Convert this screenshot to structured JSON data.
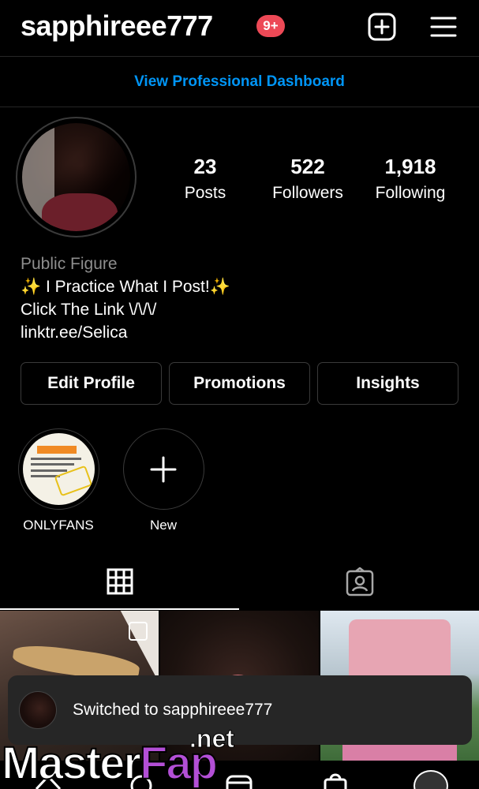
{
  "header": {
    "username": "sapphireee777",
    "notification_badge": "9+",
    "icons": [
      "add-post-icon",
      "menu-icon"
    ]
  },
  "professional_dashboard": {
    "label": "View Professional Dashboard",
    "color": "#0095f6"
  },
  "profile": {
    "stats": [
      {
        "value": "23",
        "label": "Posts"
      },
      {
        "value": "522",
        "label": "Followers"
      },
      {
        "value": "1,918",
        "label": "Following"
      }
    ],
    "category": "Public Figure",
    "bio_lines": [
      "✨ I Practice What I Post!✨",
      "Click The Link \\/\\/\\/"
    ],
    "link": "linktr.ee/Selica"
  },
  "actions": {
    "edit_profile": "Edit Profile",
    "promotions": "Promotions",
    "insights": "Insights"
  },
  "highlights": [
    {
      "label": "ONLYFANS"
    },
    {
      "label": "New"
    }
  ],
  "tabs": [
    "grid-icon",
    "tagged-icon"
  ],
  "toast": {
    "message": "Switched to sapphireee777"
  },
  "watermark": {
    "part1": "Master",
    "part2": "Fap",
    "suffix": ".net",
    "accent_color": "#b34fd6"
  },
  "colors": {
    "background": "#000000",
    "badge": "#ed4956",
    "link": "#0095f6"
  }
}
